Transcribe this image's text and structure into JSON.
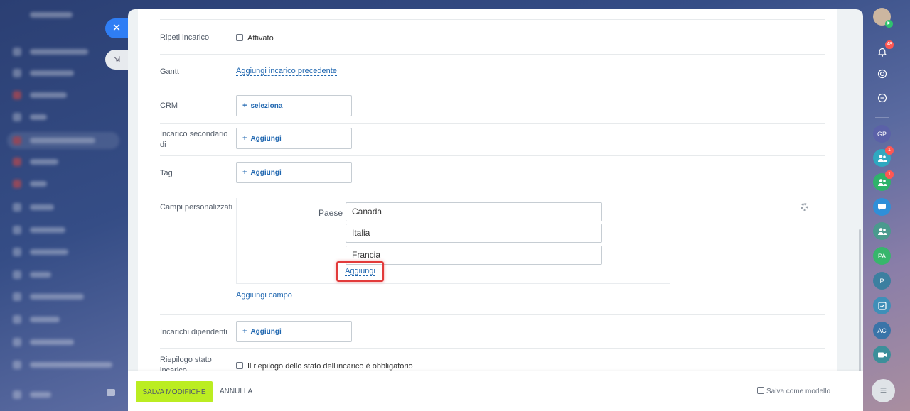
{
  "form": {
    "rows": {
      "repeat": {
        "label": "Ripeti incarico",
        "checkbox": "Attivato"
      },
      "gantt": {
        "label": "Gantt",
        "link": "Aggiungi incarico precedente"
      },
      "crm": {
        "label": "CRM",
        "button": "seleziona"
      },
      "subtask": {
        "label": "Incarico secondario di",
        "button": "Aggiungi"
      },
      "tag": {
        "label": "Tag",
        "button": "Aggiungi"
      },
      "custom_fields": {
        "label": "Campi personalizzati",
        "field_label": "Paese",
        "values": [
          "Canada",
          "Italia",
          "Francia"
        ],
        "add_value_link": "Aggiungi",
        "add_field_link": "Aggiungi campo"
      },
      "dependent": {
        "label": "Incarichi dipendenti",
        "button": "Aggiungi"
      },
      "summary": {
        "label": "Riepilogo stato incarico",
        "checkbox": "Il riepilogo dello stato dell'incarico è obbligatorio"
      }
    }
  },
  "footer": {
    "save": "SALVA MODIFICHE",
    "cancel": "ANNULLA",
    "template": "Salva come modello"
  },
  "right_bar": {
    "notifications_badge": "48",
    "group1_badge": "1",
    "group2_badge": "1",
    "avatars": [
      "GP",
      "PA",
      "P",
      "AC"
    ]
  },
  "colors": {
    "accent_link": "#2067b0",
    "save_button": "#bbed21",
    "highlight": "#e23b3b"
  }
}
